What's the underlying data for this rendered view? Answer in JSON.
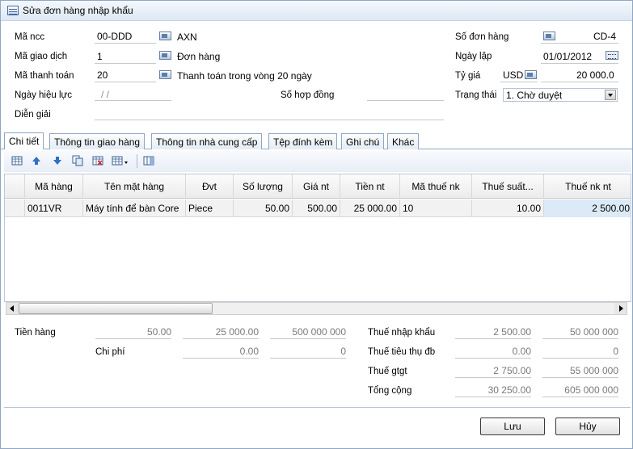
{
  "window": {
    "title": "Sửa đơn hàng nhập khẩu"
  },
  "form": {
    "ma_ncc": {
      "label": "Mã ncc",
      "value": "00-DDD",
      "name": "AXN"
    },
    "ma_giao_dich": {
      "label": "Mã giao dịch",
      "value": "1",
      "name": "Đơn hàng"
    },
    "ma_thanh_toan": {
      "label": "Mã thanh toán",
      "value": "20",
      "name": "Thanh toán trong vòng 20 ngày"
    },
    "ngay_hieu_luc": {
      "label": "Ngày hiệu lực",
      "value": "/ /"
    },
    "so_hop_dong": {
      "label": "Số hợp đồng",
      "value": ""
    },
    "dien_giai": {
      "label": "Diễn giải",
      "value": ""
    },
    "so_don_hang": {
      "label": "Số đơn hàng",
      "value": "CD-4"
    },
    "ngay_lap": {
      "label": "Ngày lập",
      "value": "01/01/2012"
    },
    "ty_gia": {
      "label": "Tỷ giá",
      "currency": "USD",
      "value": "20 000.0"
    },
    "trang_thai": {
      "label": "Trạng thái",
      "value": "1. Chờ duyệt"
    }
  },
  "tabs": [
    "Chi tiết",
    "Thông tin giao hàng",
    "Thông tin nhà cung cấp",
    "Tệp đính kèm",
    "Ghi chú",
    "Khác"
  ],
  "toolbar": {
    "icons": [
      "add-row-icon",
      "move-up-icon",
      "move-down-icon",
      "copy-icon",
      "delete-icon",
      "grid-menu-icon",
      "columns-icon"
    ]
  },
  "grid": {
    "columns": [
      "Mã hàng",
      "Tên mặt hàng",
      "Đvt",
      "Số lượng",
      "Giá nt",
      "Tiền nt",
      "Mã thuế nk",
      "Thuế suất...",
      "Thuế nk nt"
    ],
    "rows": [
      [
        "0011VR",
        "Máy tính để bàn Core",
        "Piece",
        "50.00",
        "500.00",
        "25 000.00",
        "10",
        "10.00",
        "2 500.00"
      ]
    ]
  },
  "totals": {
    "tien_hang": {
      "label": "Tiền hàng",
      "values": [
        "50.00",
        "25 000.00",
        "500 000 000"
      ]
    },
    "chi_phi": {
      "label": "Chi phí",
      "values": [
        "0.00",
        "0"
      ]
    },
    "thue_nhap_khau": {
      "label": "Thuế nhập khẩu",
      "values": [
        "2 500.00",
        "50 000 000"
      ]
    },
    "thue_tieu_thu_db": {
      "label": "Thuế tiêu thụ đb",
      "values": [
        "0.00",
        "0"
      ]
    },
    "thue_gtgt": {
      "label": "Thuế gtgt",
      "values": [
        "2 750.00",
        "55 000 000"
      ]
    },
    "tong_cong": {
      "label": "Tổng cộng",
      "values": [
        "30 250.00",
        "605 000 000"
      ]
    }
  },
  "buttons": {
    "save": "Lưu",
    "cancel": "Hủy"
  }
}
